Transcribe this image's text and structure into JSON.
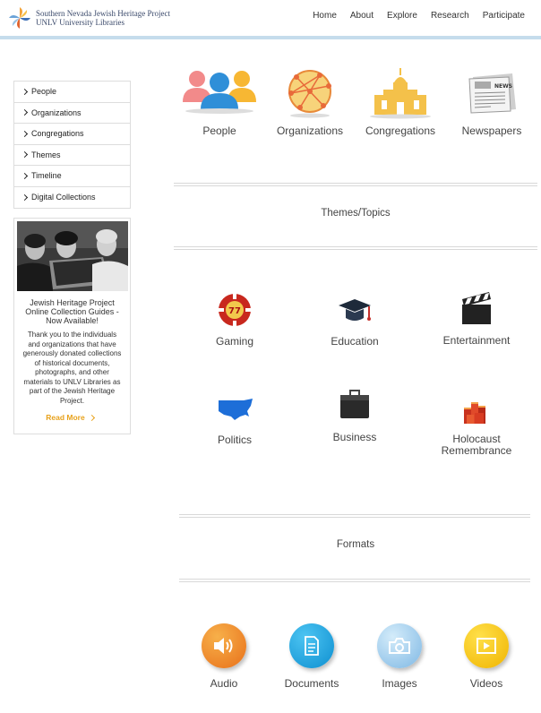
{
  "header": {
    "logo_line1": "Southern Nevada Jewish Heritage Project",
    "logo_line2": "UNLV University Libraries",
    "nav": [
      "Home",
      "About",
      "Explore",
      "Research",
      "Participate"
    ]
  },
  "sidebar": {
    "items": [
      "People",
      "Organizations",
      "Congregations",
      "Themes",
      "Timeline",
      "Digital Collections"
    ],
    "promo": {
      "title": "Jewish Heritage Project Online Collection Guides - Now Available!",
      "body": "Thank you to the individuals and organizations that have generously donated collections of historical documents, photographs, and other materials to UNLV Libraries as part of the Jewish Heritage Project.",
      "read_more": "Read More"
    }
  },
  "explore": {
    "items": [
      {
        "label": "People",
        "icon": "people-icon"
      },
      {
        "label": "Organizations",
        "icon": "network-icon"
      },
      {
        "label": "Congregations",
        "icon": "temple-icon"
      },
      {
        "label": "Newspapers",
        "icon": "newspaper-icon"
      }
    ],
    "newspaper_caption": "NEWS"
  },
  "themes": {
    "title": "Themes/Topics",
    "items": [
      {
        "label": "Gaming",
        "icon": "casino-chip-icon"
      },
      {
        "label": "Education",
        "icon": "graduation-cap-icon"
      },
      {
        "label": "Entertainment",
        "icon": "clapperboard-icon"
      },
      {
        "label": "Politics",
        "icon": "usa-map-icon"
      },
      {
        "label": "Business",
        "icon": "briefcase-icon"
      },
      {
        "label": "Holocaust Remembrance",
        "icon": "memorial-candles-icon"
      }
    ]
  },
  "formats": {
    "title": "Formats",
    "items": [
      {
        "label": "Audio",
        "icon": "speaker-icon",
        "color": "#f08a24"
      },
      {
        "label": "Documents",
        "icon": "document-icon",
        "color": "#1aa3e0"
      },
      {
        "label": "Images",
        "icon": "camera-icon",
        "color": "#8fc3e8"
      },
      {
        "label": "Videos",
        "icon": "play-icon",
        "color": "#f2c200"
      }
    ]
  },
  "colors": {
    "accent": "#e8a21c",
    "header_rule": "#c5dcec"
  }
}
